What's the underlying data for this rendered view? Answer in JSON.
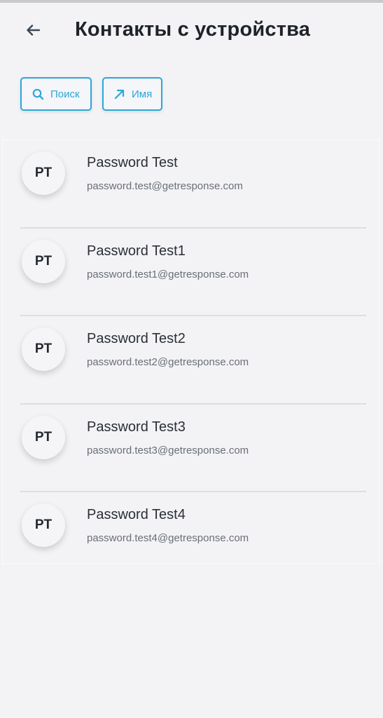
{
  "header": {
    "back_icon": "arrow-left-icon",
    "title": "Контакты с устройства"
  },
  "filters": {
    "search": {
      "icon": "search-icon",
      "label": "Поиск"
    },
    "sort": {
      "icon": "arrow-up-right-icon",
      "label": "Имя"
    }
  },
  "contacts": [
    {
      "initials": "PT",
      "name": "Password Test",
      "email": "password.test@getresponse.com"
    },
    {
      "initials": "PT",
      "name": "Password Test1",
      "email": "password.test1@getresponse.com"
    },
    {
      "initials": "PT",
      "name": "Password Test2",
      "email": "password.test2@getresponse.com"
    },
    {
      "initials": "PT",
      "name": "Password Test3",
      "email": "password.test3@getresponse.com"
    },
    {
      "initials": "PT",
      "name": "Password Test4",
      "email": "password.test4@getresponse.com"
    }
  ],
  "colors": {
    "accent": "#2aa8d8",
    "background": "#f3f3f6",
    "title_text": "#1f2329",
    "secondary_text": "#6a6f77"
  }
}
